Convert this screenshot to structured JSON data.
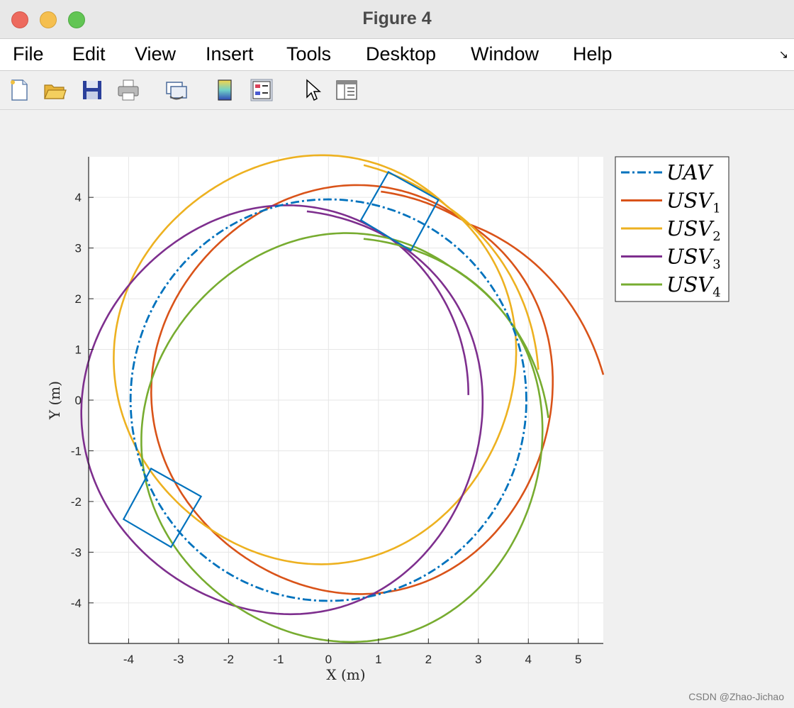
{
  "window": {
    "title": "Figure 4"
  },
  "menu": [
    "File",
    "Edit",
    "View",
    "Insert",
    "Tools",
    "Desktop",
    "Window",
    "Help"
  ],
  "toolbar": {
    "icons": [
      "new-figure-icon",
      "open-folder-icon",
      "save-icon",
      "print-icon",
      "link-plot-icon",
      "colorbar-icon",
      "legend-icon",
      "pointer-icon",
      "property-editor-icon"
    ]
  },
  "colors": {
    "uav": "#0072BD",
    "usv1": "#D95319",
    "usv2": "#EDB120",
    "usv3": "#7E2F8E",
    "usv4": "#77AC30"
  },
  "watermark": "CSDN @Zhao-Jichao",
  "chart_data": {
    "type": "line",
    "xlabel": "X (m)",
    "ylabel": "Y (m)",
    "xlim": [
      -4.8,
      5.5
    ],
    "ylim": [
      -4.8,
      4.8
    ],
    "xticks": [
      "-4",
      "-3",
      "-2",
      "-1",
      "0",
      "1",
      "2",
      "3",
      "4",
      "5"
    ],
    "yticks": [
      "-4",
      "-3",
      "-2",
      "-1",
      "0",
      "1",
      "2",
      "3",
      "4"
    ],
    "grid": true,
    "legend_position": "outside-top-right",
    "series": [
      {
        "name": "UAV",
        "sub": "",
        "style": "dash-dot",
        "circle": {
          "cx": 0,
          "cy": 0,
          "r": 3.96
        }
      },
      {
        "name": "USV",
        "sub": "1",
        "style": "solid",
        "circle": {
          "cx": 0.5,
          "cy": 0.2,
          "r": 4.0
        },
        "start": [
          5.5,
          0.5
        ]
      },
      {
        "name": "USV",
        "sub": "2",
        "style": "solid",
        "circle": {
          "cx": -0.25,
          "cy": 0.8,
          "r": 4.0
        },
        "start": [
          4.2,
          0.6
        ]
      },
      {
        "name": "USV",
        "sub": "3",
        "style": "solid",
        "circle": {
          "cx": -0.9,
          "cy": -0.2,
          "r": 4.0
        },
        "start": [
          2.8,
          0.1
        ]
      },
      {
        "name": "USV",
        "sub": "4",
        "style": "solid",
        "circle": {
          "cx": 0.3,
          "cy": -0.75,
          "r": 4.0
        },
        "start": [
          4.4,
          -0.35
        ]
      }
    ],
    "annotations": [
      {
        "type": "square",
        "corners": [
          [
            1.2,
            4.5
          ],
          [
            2.2,
            3.95
          ],
          [
            1.65,
            2.95
          ],
          [
            0.65,
            3.55
          ]
        ]
      },
      {
        "type": "square",
        "corners": [
          [
            -3.55,
            -1.35
          ],
          [
            -2.55,
            -1.9
          ],
          [
            -3.15,
            -2.9
          ],
          [
            -4.1,
            -2.35
          ]
        ]
      }
    ]
  }
}
